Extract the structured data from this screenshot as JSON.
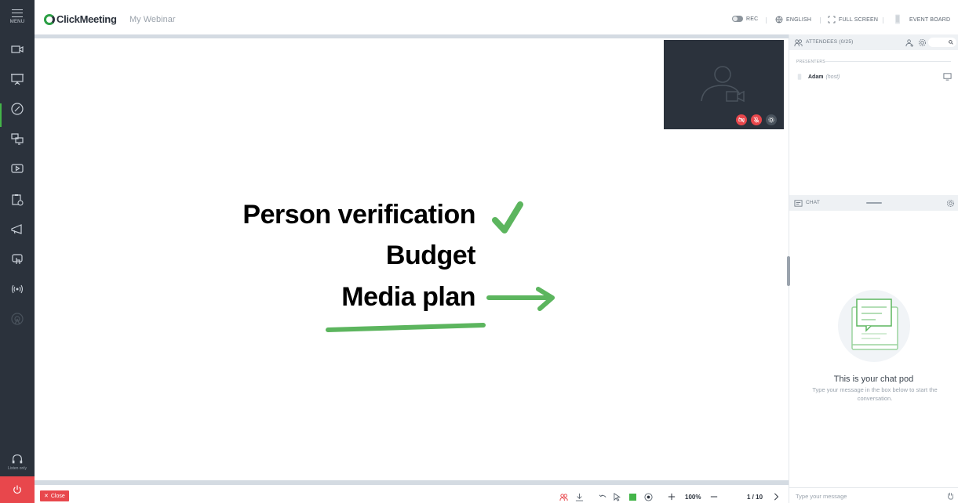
{
  "app": {
    "brand": "ClickMeeting",
    "webinar_name": "My Webinar"
  },
  "rail": {
    "menu_label": "MENU",
    "items": [
      {
        "icon": "camera-icon"
      },
      {
        "icon": "presentation-icon"
      },
      {
        "icon": "whiteboard-icon"
      },
      {
        "icon": "screen-share-icon"
      },
      {
        "icon": "video-play-icon"
      },
      {
        "icon": "clipboard-poll-icon"
      },
      {
        "icon": "megaphone-icon"
      },
      {
        "icon": "touch-icon"
      },
      {
        "icon": "broadcast-icon"
      },
      {
        "icon": "stream-icon"
      }
    ],
    "listen_label": "Listen only",
    "power_icon": "power-icon"
  },
  "topbar": {
    "rec_label": "REC",
    "language_label": "ENGLISH",
    "fullscreen_label": "FULL SCREEN",
    "event_board_label": "EVENT BOARD"
  },
  "board": {
    "lines": [
      "Person verification",
      "Budget",
      "Media plan"
    ],
    "ink_color": "#5cb55e"
  },
  "bottombar": {
    "close_label": "Close",
    "zoom": "100%",
    "page": "1 / 10",
    "active_color": "#44b549"
  },
  "attendees": {
    "title": "ATTENDEES (0/25)",
    "section_label": "PRESENTERS",
    "presenters": [
      {
        "name": "Adam",
        "role": "(host)"
      }
    ]
  },
  "chat": {
    "title": "CHAT",
    "empty_title": "This is your chat pod",
    "empty_subtitle": "Type your message in the box below to start the conversation.",
    "input_placeholder": "Type your message"
  },
  "colors": {
    "sidebar": "#2b323c",
    "accent": "#44b549",
    "danger": "#e8474c"
  }
}
